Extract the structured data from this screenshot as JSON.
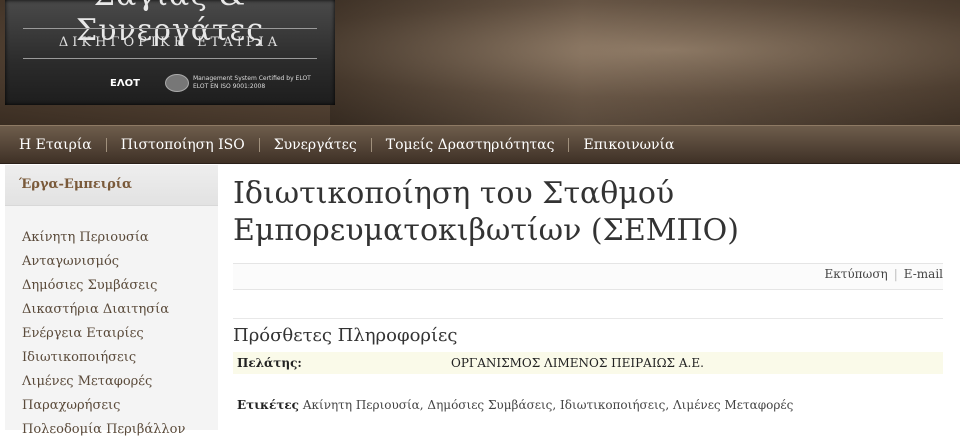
{
  "logo": {
    "name": "Σάγιας & Συνεργάτες",
    "subtitle": "ΔΙΚΗΓΟΡΙΚΗ ΕΤΑΙΡΙΑ",
    "elot": "ΕΛΟΤ",
    "cert_line1": "Management System Certified by ELOT",
    "cert_line2": "ELOT EN ISO 9001:2008"
  },
  "nav": [
    "Η Εταιρία",
    "Πιστοποίηση ISO",
    "Συνεργάτες",
    "Τομείς Δραστηριότητας",
    "Επικοινωνία"
  ],
  "sidebar": {
    "title": "Έργα-Εμπειρία",
    "items": [
      "Ακίνητη Περιουσία",
      "Ανταγωνισμός",
      "Δημόσιες Συμβάσεις",
      "Δικαστήρια Διαιτησία",
      "Ενέργεια Εταιρίες",
      "Ιδιωτικοποιήσεις",
      "Λιμένες Μεταφορές",
      "Παραχωρήσεις",
      "Πολεοδομία Περιβάλλον"
    ]
  },
  "main": {
    "title_line1": "Ιδιωτικοποίηση του Σταθμού",
    "title_line2": "Εμπορευματοκιβωτίων (ΣΕΜΠΟ)",
    "print_label": "Εκτύπωση",
    "email_label": "E-mail",
    "section_title": "Πρόσθετες Πληροφορίες",
    "client_label": "Πελάτης:",
    "client_value": "ΟΡΓΑΝΙΣΜΟΣ ΛΙΜΕΝΟΣ ΠΕΙΡΑΙΩΣ Α.Ε.",
    "tags_label": "Ετικέτες",
    "tags_text": "Ακίνητη Περιουσία, Δημόσιες Συμβάσεις, Ιδιωτικοποιήσεις, Λιμένες Μεταφορές"
  }
}
